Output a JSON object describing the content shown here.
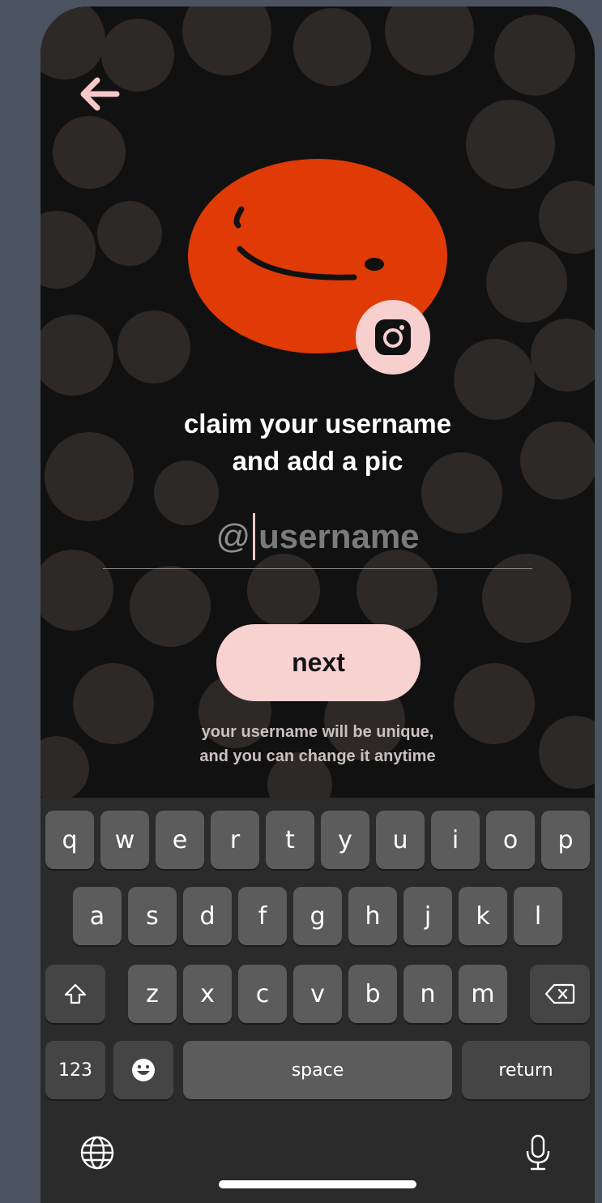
{
  "header": {
    "back_icon": "arrow-left-icon"
  },
  "avatar": {
    "fill_color": "#e03a06",
    "badge_icon": "camera-icon"
  },
  "title": "claim your username\nand add a pic",
  "username_input": {
    "prefix": "@",
    "placeholder": "username",
    "value": ""
  },
  "next_button": {
    "label": "next"
  },
  "hint": "your username will be unique,\nand you can change it anytime",
  "keyboard": {
    "row1": [
      "q",
      "w",
      "e",
      "r",
      "t",
      "y",
      "u",
      "i",
      "o",
      "p"
    ],
    "row2": [
      "a",
      "s",
      "d",
      "f",
      "g",
      "h",
      "j",
      "k",
      "l"
    ],
    "row3": [
      "z",
      "x",
      "c",
      "v",
      "b",
      "n",
      "m"
    ],
    "numbers_label": "123",
    "space_label": "space",
    "return_label": "return",
    "shift_icon": "shift-icon",
    "backspace_icon": "backspace-icon",
    "emoji_icon": "emoji-icon",
    "globe_icon": "globe-icon",
    "mic_icon": "microphone-icon"
  },
  "colors": {
    "accent_pink": "#f8d2d0",
    "avatar_orange": "#e03a06",
    "background": "#121111"
  }
}
